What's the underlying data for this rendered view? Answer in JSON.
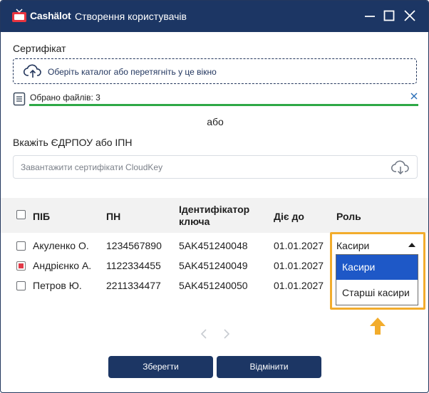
{
  "window": {
    "brand": "Cashälot",
    "title": "Створення користувачів"
  },
  "certificate": {
    "label": "Сертифікат",
    "dropzone_text": "Оберіть каталог або перетягніть у це вікно",
    "selected_files_text": "Обрано файлів: 3",
    "upload_progress": 1.0
  },
  "or_text": "або",
  "code": {
    "label": "Вкажіть ЄДРПОУ або ІПН",
    "placeholder": "Завантажити сертифікати CloudKey"
  },
  "table": {
    "columns": [
      "ПІБ",
      "ПН",
      "Ідентифікатор ключа",
      "Діє до",
      "Роль"
    ],
    "rows": [
      {
        "name": "Акуленко О.",
        "pn": "1234567890",
        "key": "5AK451240048",
        "valid": "01.01.2027",
        "checked": false
      },
      {
        "name": "Андрієнко А.",
        "pn": "1122334455",
        "key": "5AK451240049",
        "valid": "01.01.2027",
        "checked": true
      },
      {
        "name": "Петров Ю.",
        "pn": "2211334477",
        "key": "5AK451240050",
        "valid": "01.01.2027",
        "checked": false
      }
    ]
  },
  "role_select": {
    "current": "Касири",
    "options": [
      "Касири",
      "Старші касири"
    ]
  },
  "buttons": {
    "save": "Зберегти",
    "cancel": "Відмінити"
  },
  "colors": {
    "titlebar": "#1c3664",
    "progress": "#2ea846",
    "highlight": "#f2ac2c",
    "option_selected": "#1e58c7",
    "checkbox_checked": "#e23a48"
  },
  "icons": [
    "tv-logo-icon",
    "minimize-icon",
    "maximize-icon",
    "close-icon",
    "cloud-upload-icon",
    "document-icon",
    "clear-icon",
    "cloud-download-icon",
    "caret-up-icon",
    "arrow-up-icon",
    "chevron-left-icon",
    "chevron-right-icon"
  ]
}
